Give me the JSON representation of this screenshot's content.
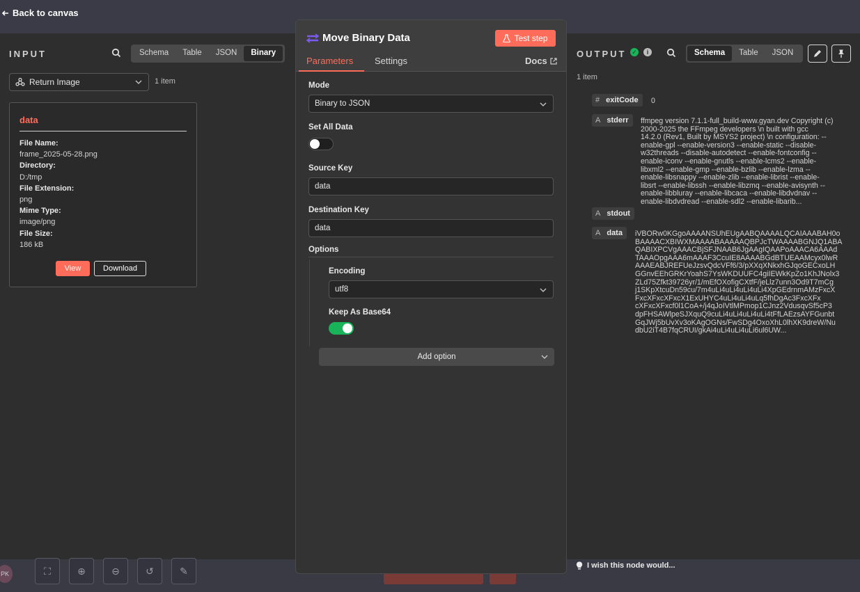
{
  "topbar": {
    "back_label": "Back to canvas"
  },
  "input": {
    "title": "INPUT",
    "tabs": [
      {
        "label": "Schema"
      },
      {
        "label": "Table"
      },
      {
        "label": "JSON"
      },
      {
        "label": "Binary"
      }
    ],
    "node_select": "Return Image",
    "count": "1 item",
    "binary": {
      "title": "data",
      "file_name_label": "File Name:",
      "file_name": "frame_2025-05-28.png",
      "directory_label": "Directory:",
      "directory": "D:/tmp",
      "extension_label": "File Extension:",
      "extension": "png",
      "mime_label": "Mime Type:",
      "mime": "image/png",
      "size_label": "File Size:",
      "size": "186 kB",
      "view_label": "View",
      "download_label": "Download"
    }
  },
  "node": {
    "title": "Move Binary Data",
    "test_label": "Test step",
    "tabs": [
      {
        "label": "Parameters"
      },
      {
        "label": "Settings"
      }
    ],
    "docs_label": "Docs",
    "mode_label": "Mode",
    "mode_value": "Binary to JSON",
    "set_all_label": "Set All Data",
    "set_all_value": false,
    "source_key_label": "Source Key",
    "source_key_value": "data",
    "dest_key_label": "Destination Key",
    "dest_key_value": "data",
    "options_label": "Options",
    "encoding_label": "Encoding",
    "encoding_value": "utf8",
    "keep_base64_label": "Keep As Base64",
    "keep_base64_value": true,
    "add_option_label": "Add option"
  },
  "output": {
    "title": "OUTPUT",
    "tabs": [
      {
        "label": "Schema"
      },
      {
        "label": "Table"
      },
      {
        "label": "JSON"
      }
    ],
    "count": "1 item",
    "fields": [
      {
        "type": "#",
        "key": "exitCode",
        "value": "0"
      },
      {
        "type": "A",
        "key": "stderr",
        "value_lines": [
          "ffmpeg version 7.1.1-full_build-www.gyan.dev Copyright (c)",
          "2000-2025 the FFmpeg developers \\n  built with gcc",
          "14.2.0 (Rev1, Built by MSYS2 project) \\n  configuration: --",
          "enable-gpl --enable-version3 --enable-static --disable-",
          "w32threads --disable-autodetect --enable-fontconfig --",
          "enable-iconv --enable-gnutls --enable-lcms2 --enable-",
          "libxml2 --enable-gmp --enable-bzlib --enable-lzma --",
          "enable-libsnappy --enable-zlib --enable-librist --enable-",
          "libsrt --enable-libssh --enable-libzmq --enable-avisynth --",
          "enable-libbluray --enable-libcaca --enable-libdvdnav --",
          "enable-libdvdread --enable-sdl2 --enable-libarib..."
        ]
      },
      {
        "type": "A",
        "key": "stdout",
        "value": ""
      },
      {
        "type": "A",
        "key": "data",
        "value_lines": [
          "iVBORw0KGgoAAAANSUhEUgAABQAAAALQCAIAAABAH0o",
          "BAAAACXBIWXMAAAABAAAAAQBPJcTWAAAABGNJQ1ABA",
          "QABIXPCVgAAACBjSFJNAAB6JgAAgIQAAPoAAACA6AAAd",
          "TAAAOpgAAA6mAAAF3CcuIE8AAAABGdBTUEAAMcyx0lwR",
          "AAAEABJREFUeJzsvQdcVFf6/3/pXXqXNkxhGJqoGECxoLH",
          "GGnvEEhGRKrYoahS7YsWKDUUFC4giIEWkKpZo1KhJNolx3",
          "ZLd75Zfkt39726yr/1/mEfOXofigCXtfF/jeLlz7unn3Od9T7mCg",
          "j1SKpXtcuDn59cu/7m4uLi4uLi4uLi4uLi4XpGEdrnmAMzFxcX",
          "FxcXFxcXFxcX1ExUHYC4uLi4uLi4uLq5fhDgAc3FxcXFx",
          "cXFxcXFxcf0l1CoA+/j4qJoIVtlMPmop1CJnz2VdusqvSf5cP3",
          "dpFHSAWlpeSJXquQ9cuLi4uLi4uLi4uLi4tFfLAEzsAYFGunbt",
          "GqJWj5bUvXv3oKAgOGNs/FwSDg4OxoXhL0lhXK9dreW/Nu",
          "dbU2iT4B7fqCRUI/gkAi4uLi4uLi4uLi6ul6UW..."
        ]
      }
    ]
  },
  "footer": {
    "wish_label": "I wish this node would...",
    "avatar": "PK"
  },
  "colors": {
    "accent": "#ff6d5a",
    "success": "#19b45a"
  }
}
